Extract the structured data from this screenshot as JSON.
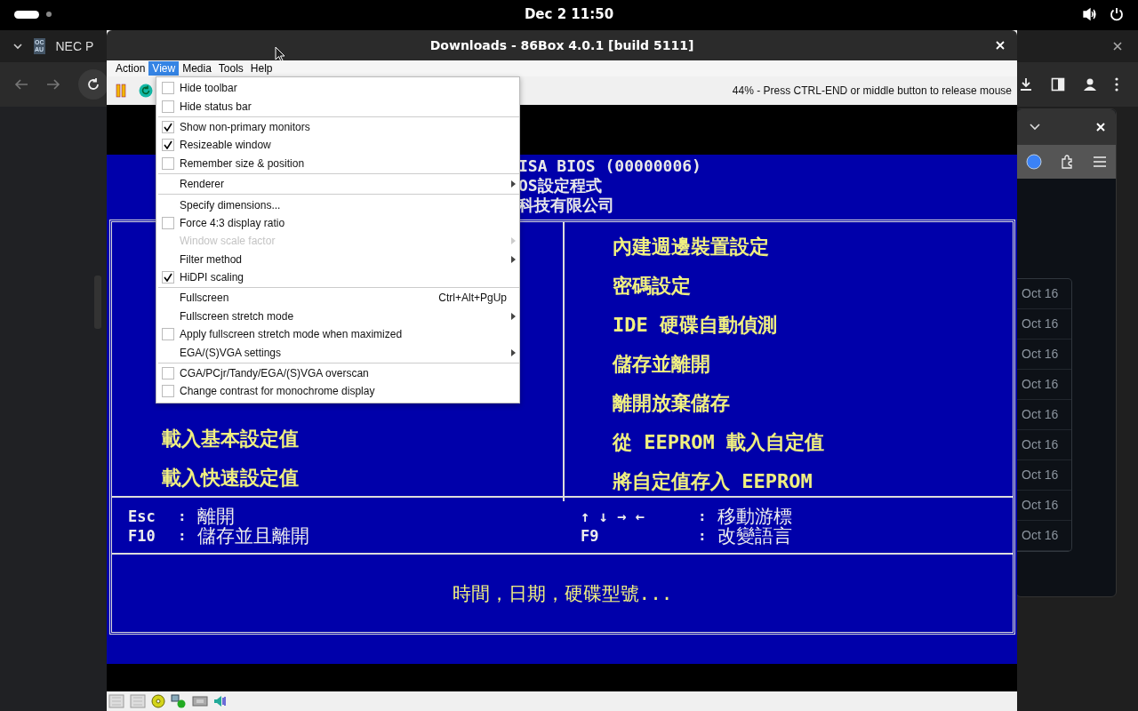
{
  "topbar": {
    "clock": "Dec 2  11:50"
  },
  "browser": {
    "favicon_lines": [
      "OC",
      "AU"
    ],
    "tab_title": "NEC P",
    "dates": [
      "Oct 16",
      "Oct 16",
      "Oct 16",
      "Oct 16",
      "Oct 16",
      "Oct 16",
      "Oct 16",
      "Oct 16",
      "Oct 16"
    ]
  },
  "window": {
    "title": "Downloads - 86Box 4.0.1 [build 5111]"
  },
  "menubar": [
    {
      "label": "Action",
      "selected": false
    },
    {
      "label": "View",
      "selected": true
    },
    {
      "label": "Media",
      "selected": false
    },
    {
      "label": "Tools",
      "selected": false
    },
    {
      "label": "Help",
      "selected": false
    }
  ],
  "toolbar": {
    "status_message": "44% - Press CTRL-END or middle button to release mouse"
  },
  "view_menu": [
    {
      "kind": "check",
      "label": "Hide toolbar",
      "checked": false,
      "disabled": false
    },
    {
      "kind": "check",
      "label": "Hide status bar",
      "checked": false,
      "disabled": false
    },
    {
      "kind": "separator"
    },
    {
      "kind": "check",
      "label": "Show non-primary monitors",
      "checked": true,
      "disabled": false
    },
    {
      "kind": "check",
      "label": "Resizeable window",
      "checked": true,
      "disabled": false
    },
    {
      "kind": "check",
      "label": "Remember size & position",
      "checked": false,
      "disabled": false
    },
    {
      "kind": "separator"
    },
    {
      "kind": "submenu",
      "label": "Renderer",
      "disabled": false
    },
    {
      "kind": "separator"
    },
    {
      "kind": "action",
      "label": "Specify dimensions...",
      "disabled": false
    },
    {
      "kind": "check",
      "label": "Force 4:3 display ratio",
      "checked": false,
      "disabled": false
    },
    {
      "kind": "submenu",
      "label": "Window scale factor",
      "disabled": true
    },
    {
      "kind": "submenu",
      "label": "Filter method",
      "disabled": false
    },
    {
      "kind": "check",
      "label": "HiDPI scaling",
      "checked": true,
      "disabled": false
    },
    {
      "kind": "separator"
    },
    {
      "kind": "action",
      "label": "Fullscreen",
      "shortcut": "Ctrl+Alt+PgUp",
      "disabled": false
    },
    {
      "kind": "submenu",
      "label": "Fullscreen stretch mode",
      "disabled": false
    },
    {
      "kind": "check",
      "label": "Apply fullscreen stretch mode when maximized",
      "checked": false,
      "disabled": false
    },
    {
      "kind": "submenu",
      "label": "EGA/(S)VGA settings",
      "disabled": false
    },
    {
      "kind": "separator"
    },
    {
      "kind": "check",
      "label": "CGA/PCjr/Tandy/EGA/(S)VGA overscan",
      "checked": false,
      "disabled": false
    },
    {
      "kind": "check",
      "label": "Change contrast for monochrome display",
      "checked": false,
      "disabled": false
    }
  ],
  "bios": {
    "header": [
      "ISA BIOS (00000006)",
      "OS設定程式",
      "科技有限公司"
    ],
    "left_items": [
      "載入基本設定值",
      "載入快速設定值"
    ],
    "right_items": [
      "內建週邊裝置設定",
      "密碼設定",
      "IDE 硬碟自動偵測",
      "儲存並離開",
      "離開放棄儲存",
      "從 EEPROM 載入自定值",
      "將自定值存入 EEPROM"
    ],
    "left_keys": [
      {
        "key": "Esc",
        "separator": ":",
        "action": "離開"
      },
      {
        "key": "F10",
        "separator": ":",
        "action": "儲存並且離開"
      }
    ],
    "right_keys": [
      {
        "key": "↑ ↓ → ←",
        "separator": ":",
        "action": "移動游標"
      },
      {
        "key": "F9",
        "separator": ":",
        "action": "改變語言"
      }
    ],
    "footer": "時間，日期，硬碟型號..."
  }
}
